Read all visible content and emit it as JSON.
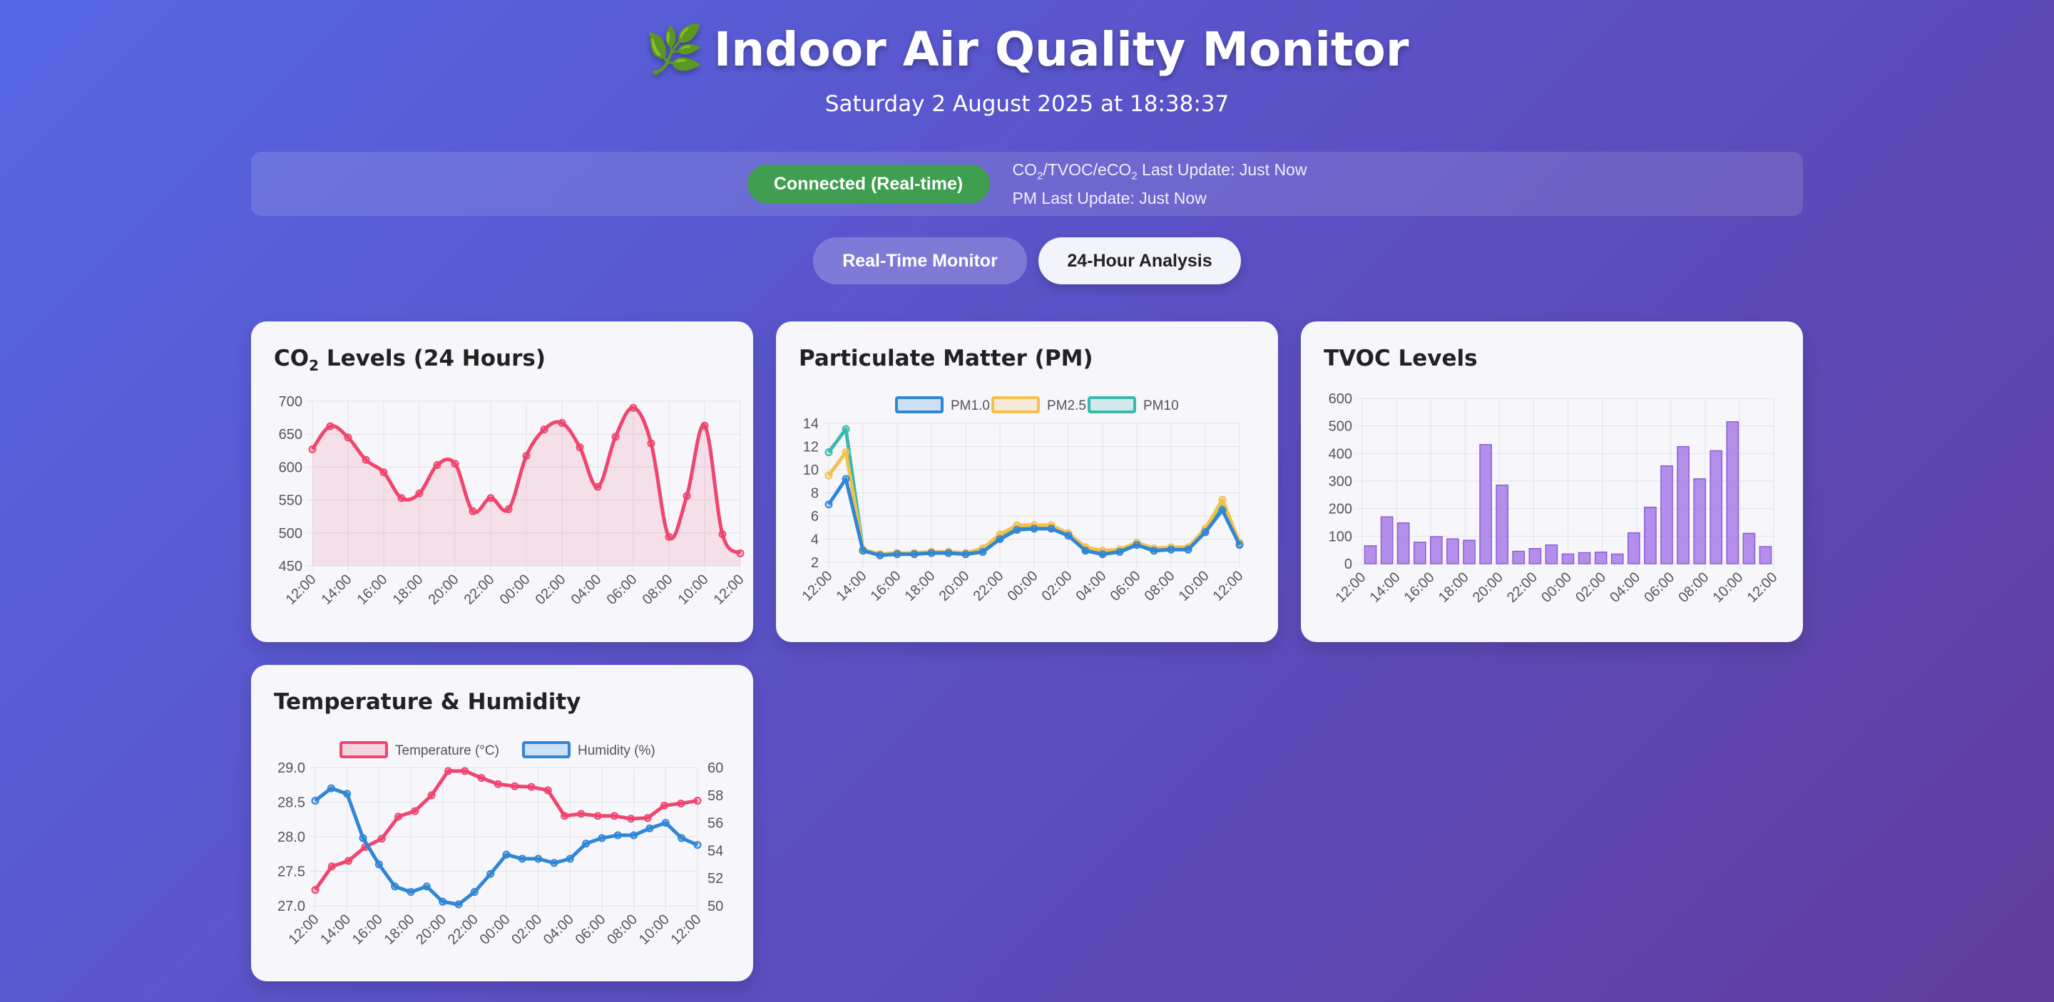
{
  "header": {
    "icon": "leaf-icon",
    "title": "Indoor Air Quality Monitor",
    "datetime": "Saturday 2 August 2025 at 18:38:37"
  },
  "status": {
    "connection": "Connected (Real-time)",
    "gas_update_label": "CO",
    "gas_update_label_rest": "/TVOC/eCO",
    "gas_update_suffix": " Last Update: Just Now",
    "pm_update": "PM Last Update: Just Now",
    "connected_color": "#3f9e4f"
  },
  "tabs": [
    {
      "label": "Real-Time Monitor",
      "active": false
    },
    {
      "label": "24-Hour Analysis",
      "active": true
    }
  ],
  "cards": {
    "co2_title_a": "CO",
    "co2_title_b": " Levels (24 Hours)",
    "pm_title": "Particulate Matter (PM)",
    "tvoc_title": "TVOC Levels",
    "th_title": "Temperature & Humidity"
  },
  "chart_data": [
    {
      "id": "co2",
      "type": "line",
      "fill": true,
      "x_ticks": [
        "12:00",
        "14:00",
        "16:00",
        "18:00",
        "20:00",
        "22:00",
        "00:00",
        "02:00",
        "04:00",
        "06:00",
        "08:00",
        "10:00",
        "12:00"
      ],
      "ylim": [
        450,
        700
      ],
      "y_ticks": [
        450,
        500,
        550,
        600,
        650,
        700
      ],
      "x": [
        0,
        1,
        2,
        3,
        4,
        5,
        6,
        7,
        8,
        9,
        10,
        11,
        12,
        13,
        14,
        15,
        16,
        17,
        18,
        19,
        20,
        21,
        22,
        23,
        24
      ],
      "values": [
        627,
        662,
        645,
        611,
        592,
        553,
        560,
        603,
        605,
        533,
        553,
        536,
        617,
        657,
        667,
        630,
        570,
        646,
        690,
        636,
        494,
        556,
        663,
        498,
        469
      ],
      "color": "#f0456e"
    },
    {
      "id": "pm",
      "type": "line",
      "x_ticks": [
        "12:00",
        "14:00",
        "16:00",
        "18:00",
        "20:00",
        "22:00",
        "00:00",
        "02:00",
        "04:00",
        "06:00",
        "08:00",
        "10:00",
        "12:00"
      ],
      "ylim": [
        2,
        14
      ],
      "y_ticks": [
        2,
        4,
        6,
        8,
        10,
        12,
        14
      ],
      "x": [
        0,
        1,
        2,
        3,
        4,
        5,
        6,
        7,
        8,
        9,
        10,
        11,
        12,
        13,
        14,
        15,
        16,
        17,
        18,
        19,
        20,
        21,
        22,
        23,
        24,
        25
      ],
      "series": [
        {
          "name": "PM1.0",
          "color": "#2f86d6",
          "values": [
            7.0,
            9.2,
            3.0,
            2.6,
            2.7,
            2.7,
            2.8,
            2.8,
            2.7,
            2.9,
            4.0,
            4.8,
            4.9,
            4.9,
            4.3,
            3.0,
            2.7,
            2.9,
            3.5,
            3.0,
            3.1,
            3.1,
            4.6,
            6.5,
            3.5
          ]
        },
        {
          "name": "PM2.5",
          "color": "#f4c04a",
          "values": [
            9.5,
            11.5,
            3.1,
            2.7,
            2.8,
            2.8,
            2.9,
            2.9,
            2.8,
            3.2,
            4.4,
            5.2,
            5.2,
            5.2,
            4.5,
            3.3,
            3.0,
            3.1,
            3.7,
            3.2,
            3.3,
            3.3,
            4.9,
            7.4,
            3.7
          ]
        },
        {
          "name": "PM10",
          "color": "#3bb8b0",
          "values": [
            11.5,
            13.5,
            3.1,
            2.7,
            2.8,
            2.8,
            2.8,
            2.8,
            2.7,
            2.9,
            4.1,
            4.9,
            5.0,
            5.0,
            4.3,
            3.1,
            2.8,
            2.9,
            3.5,
            3.0,
            3.1,
            3.1,
            4.7,
            6.8,
            3.6
          ]
        }
      ]
    },
    {
      "id": "tvoc",
      "type": "bar",
      "x_ticks": [
        "12:00",
        "14:00",
        "16:00",
        "18:00",
        "20:00",
        "22:00",
        "00:00",
        "02:00",
        "04:00",
        "06:00",
        "08:00",
        "10:00",
        "12:00"
      ],
      "ylim": [
        0,
        600
      ],
      "y_ticks": [
        0,
        100,
        200,
        300,
        400,
        500,
        600
      ],
      "values": [
        65,
        170,
        148,
        78,
        98,
        90,
        85,
        432,
        285,
        45,
        55,
        68,
        35,
        40,
        42,
        35,
        112,
        205,
        355,
        425,
        308,
        410,
        515,
        110,
        62
      ],
      "color": "#a77de8"
    },
    {
      "id": "temp_humidity",
      "type": "line",
      "x_ticks": [
        "12:00",
        "14:00",
        "16:00",
        "18:00",
        "20:00",
        "22:00",
        "00:00",
        "02:00",
        "04:00",
        "06:00",
        "08:00",
        "10:00",
        "12:00"
      ],
      "ylim_left": [
        27.0,
        29.0
      ],
      "y_ticks_left": [
        "27.0",
        "27.5",
        "28.0",
        "28.5",
        "29.0"
      ],
      "ylim_right": [
        50,
        60
      ],
      "y_ticks_right": [
        50,
        52,
        54,
        56,
        58,
        60
      ],
      "series": [
        {
          "name": "Temperature (°C)",
          "axis": "left",
          "color": "#f0456e",
          "values": [
            27.23,
            27.57,
            27.65,
            27.85,
            27.97,
            28.29,
            28.37,
            28.6,
            28.95,
            28.95,
            28.85,
            28.76,
            28.73,
            28.72,
            28.67,
            28.3,
            28.33,
            28.3,
            28.3,
            28.26,
            28.27,
            28.45,
            28.48,
            28.52
          ]
        },
        {
          "name": "Humidity (%)",
          "axis": "right",
          "color": "#2f86d6",
          "values": [
            57.6,
            58.5,
            58.1,
            54.9,
            53.0,
            51.4,
            51.0,
            51.4,
            50.3,
            50.1,
            51.0,
            52.3,
            53.7,
            53.4,
            53.4,
            53.1,
            53.4,
            54.5,
            54.9,
            55.1,
            55.1,
            55.6,
            56.0,
            54.9,
            54.4
          ]
        }
      ]
    }
  ]
}
